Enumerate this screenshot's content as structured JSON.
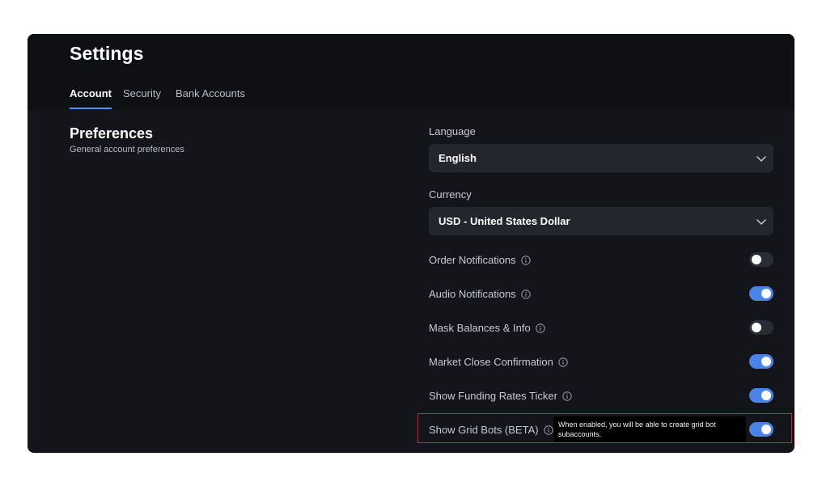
{
  "header": {
    "title": "Settings",
    "tabs": [
      {
        "label": "Account",
        "active": true
      },
      {
        "label": "Security",
        "active": false
      },
      {
        "label": "Bank Accounts",
        "active": false
      }
    ]
  },
  "preferences": {
    "title": "Preferences",
    "subtitle": "General account preferences"
  },
  "language": {
    "label": "Language",
    "value": "English"
  },
  "currency": {
    "label": "Currency",
    "value": "USD - United States Dollar"
  },
  "toggles": [
    {
      "label": "Order Notifications",
      "on": false
    },
    {
      "label": "Audio Notifications",
      "on": true
    },
    {
      "label": "Mask Balances & Info",
      "on": false
    },
    {
      "label": "Market Close Confirmation",
      "on": true
    },
    {
      "label": "Show Funding Rates Ticker",
      "on": true
    },
    {
      "label": "Show Grid Bots (BETA)",
      "on": true
    }
  ],
  "tooltip": {
    "text": "When enabled, you will be able to create grid bot subaccounts."
  },
  "colors": {
    "accent": "#4b84e8",
    "highlight": "#e02424",
    "background": "#14151b"
  },
  "icons": {
    "info": "info-circle-icon",
    "dropdown": "chevron-down-icon"
  }
}
